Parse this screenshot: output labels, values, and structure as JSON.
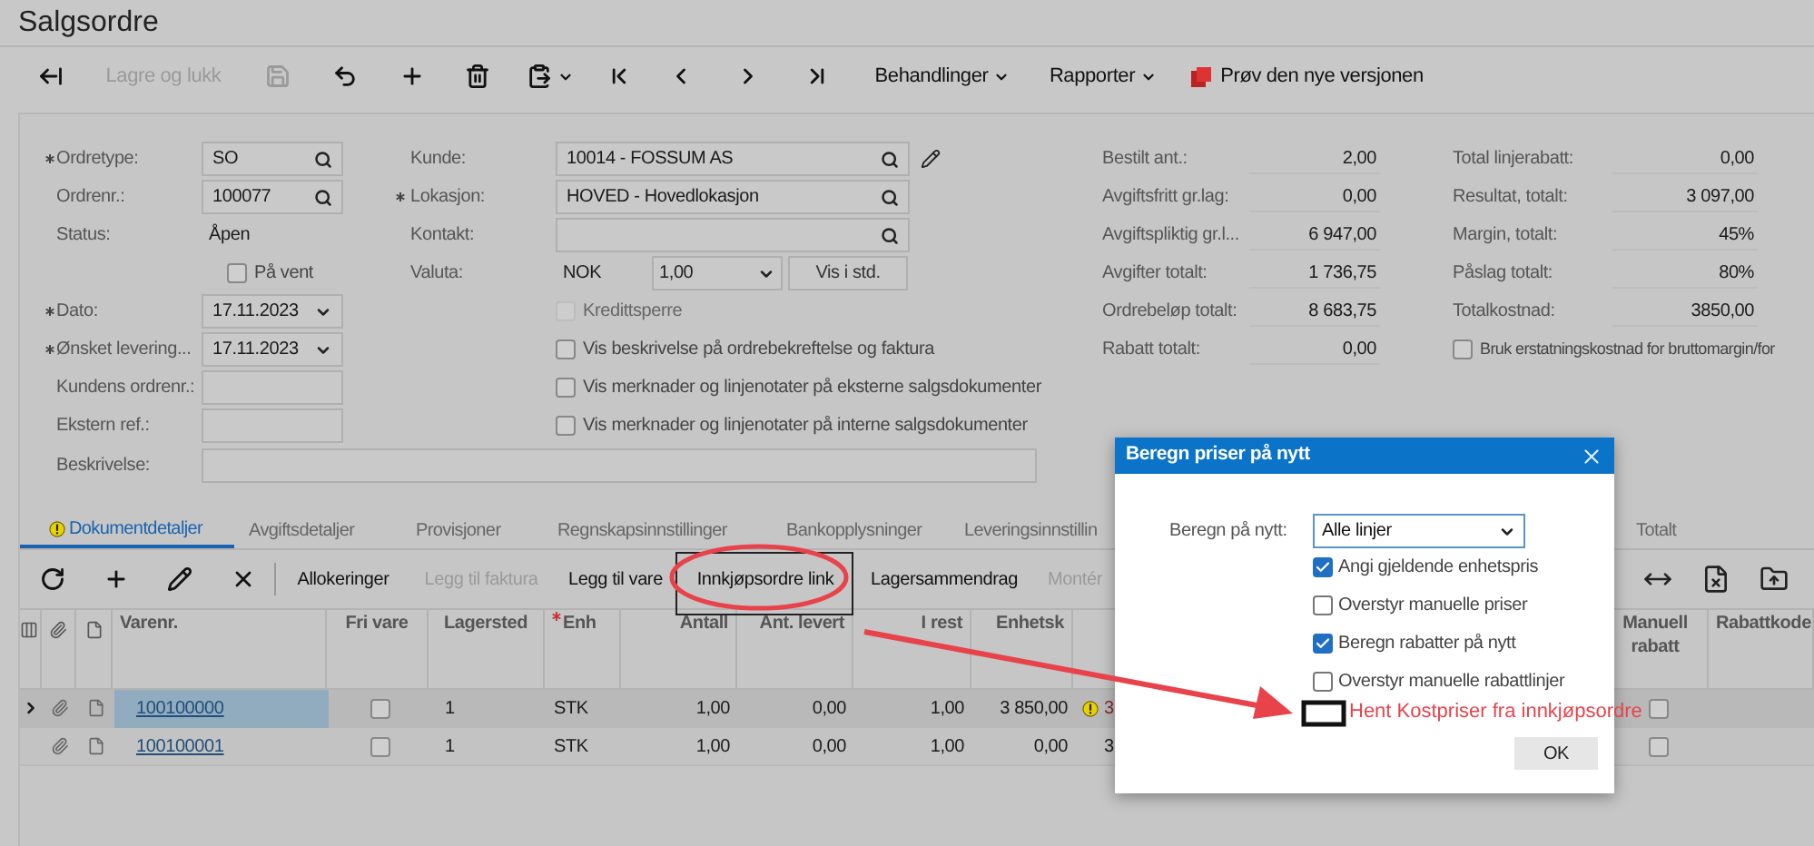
{
  "title": "Salgsordre",
  "toolbar": [
    {
      "kind": "icon",
      "disabled": false
    },
    {
      "kind": "text",
      "label": "Lagre og lukk",
      "disabled": true
    },
    {
      "kind": "icon",
      "disabled": true
    },
    {
      "kind": "icon",
      "disabled": false
    },
    {
      "kind": "icon",
      "disabled": false
    },
    {
      "kind": "icon",
      "disabled": false
    },
    {
      "kind": "icon-menu",
      "disabled": false
    },
    {
      "kind": "icon",
      "disabled": false
    },
    {
      "kind": "icon",
      "disabled": false
    },
    {
      "kind": "icon",
      "disabled": false
    },
    {
      "kind": "icon",
      "disabled": false
    },
    {
      "kind": "menu",
      "label": "Behandlinger",
      "disabled": false
    },
    {
      "kind": "menu",
      "label": "Rapporter",
      "disabled": false
    },
    {
      "kind": "promo",
      "label": "Prøv den nye versjonen",
      "disabled": false
    }
  ],
  "left_fields": [
    {
      "kind": "lookup",
      "label": "Ordretype:",
      "required": true,
      "value": "SO"
    },
    {
      "kind": "lookup",
      "label": "Ordrenr.:",
      "required": false,
      "value": "100077"
    },
    {
      "kind": "text",
      "label": "Status:",
      "required": false,
      "value": "Åpen"
    },
    {
      "kind": "checkbox",
      "label": "På vent",
      "checked": false
    },
    {
      "kind": "date",
      "label": "Dato:",
      "required": true,
      "value": "17.11.2023"
    },
    {
      "kind": "date",
      "label": "Ønsket levering...",
      "required": true,
      "value": "17.11.2023"
    },
    {
      "kind": "input",
      "label": "Kundens ordrenr.:",
      "required": false
    },
    {
      "kind": "input",
      "label": "Ekstern ref.:",
      "required": false
    }
  ],
  "description": {
    "label": "Beskrivelse:"
  },
  "middle_fields": [
    {
      "kind": "lookup_editable",
      "label": "Kunde:",
      "required": false,
      "value": "10014 - FOSSUM AS"
    },
    {
      "kind": "lookup",
      "label": "Lokasjon:",
      "required": true,
      "value": "HOVED - Hovedlokasjon"
    },
    {
      "kind": "lookup",
      "label": "Kontakt:",
      "required": false
    },
    {
      "kind": "currency",
      "label": "Valuta:",
      "required": false,
      "value": "NOK",
      "rate": "1,00",
      "button": "Vis i std."
    },
    {
      "kind": "checkbox",
      "label": "Kredittsperre",
      "checked": false,
      "disabled": true
    },
    {
      "kind": "checkbox",
      "label": "Vis beskrivelse på ordrebekreftelse og faktura",
      "checked": false,
      "disabled": false
    },
    {
      "kind": "checkbox",
      "label": "Vis merknader og linjenotater på eksterne salgsdokumenter",
      "checked": false,
      "disabled": false
    },
    {
      "kind": "checkbox",
      "label": "Vis merknader og linjenotater på interne salgsdokumenter",
      "checked": false,
      "disabled": false
    }
  ],
  "summary_1": [
    {
      "label": "Bestilt ant.:",
      "value": "2,00"
    },
    {
      "label": "Avgiftsfritt gr.lag:",
      "value": "0,00"
    },
    {
      "label": "Avgiftspliktig gr.l...",
      "value": "6 947,00"
    },
    {
      "label": "Avgifter totalt:",
      "value": "1 736,75"
    },
    {
      "label": "Ordrebeløp totalt:",
      "value": "8 683,75"
    },
    {
      "label": "Rabatt totalt:",
      "value": "0,00"
    }
  ],
  "summary_2": [
    {
      "label": "Total linjerabatt:",
      "value": "0,00"
    },
    {
      "label": "Resultat, totalt:",
      "value": "3 097,00"
    },
    {
      "label": "Margin, totalt:",
      "value": "45%"
    },
    {
      "label": "Påslag totalt:",
      "value": "80%"
    },
    {
      "label": "Totalkostnad:",
      "value": "3850,00"
    }
  ],
  "summary_checkbox": {
    "label": "Bruk erstatningskostnad for bruttomargin/for",
    "checked": false
  },
  "tabs": [
    {
      "label": "Dokumentdetaljer",
      "selected": true,
      "warning": true
    },
    {
      "label": "Avgiftsdetaljer",
      "selected": false,
      "warning": false
    },
    {
      "label": "Provisjoner",
      "selected": false,
      "warning": false
    },
    {
      "label": "Regnskapsinnstillinger",
      "selected": false,
      "warning": false
    },
    {
      "label": "Bankopplysninger",
      "selected": false,
      "warning": false
    },
    {
      "label": "Leveringsinnstillin",
      "selected": false,
      "warning": false
    },
    {
      "label": "Totalt",
      "selected": false,
      "warning": false
    }
  ],
  "grid_toolbar": [
    {
      "kind": "icon",
      "disabled": false
    },
    {
      "kind": "icon",
      "disabled": false
    },
    {
      "kind": "icon",
      "disabled": false
    },
    {
      "kind": "icon",
      "disabled": false
    },
    {
      "kind": "separator"
    },
    {
      "kind": "text",
      "label": "Allokeringer",
      "disabled": false
    },
    {
      "kind": "text",
      "label": "Legg til faktura",
      "disabled": true
    },
    {
      "kind": "text",
      "label": "Legg til vare",
      "disabled": false
    },
    {
      "kind": "text",
      "label": "Innkjøpsordre link",
      "disabled": false
    },
    {
      "kind": "text",
      "label": "Lagersammendrag",
      "disabled": false
    },
    {
      "kind": "text",
      "label": "Montér",
      "disabled": true
    }
  ],
  "table": {
    "columns": [
      {
        "label": "Varenr.",
        "required": false
      },
      {
        "label": "Fri vare",
        "required": false
      },
      {
        "label": "Lagersted",
        "required": false
      },
      {
        "label": "Enh",
        "required": true
      },
      {
        "label": "Antall",
        "required": false
      },
      {
        "label": "Ant. levert",
        "required": false
      },
      {
        "label": "I rest",
        "required": false
      },
      {
        "label": "Enhetsk",
        "required": false
      },
      {
        "label": "Manuell rabatt",
        "required": false
      },
      {
        "label": "Rabattkode",
        "required": false
      }
    ],
    "rows": [
      {
        "selected": true,
        "varenr": "100100000",
        "fri_vare": false,
        "lagersted": "1",
        "enh": "STK",
        "antall": "1,00",
        "levert": "0,00",
        "rest": "1,00",
        "enhetsk": "3 850,00",
        "warning": true,
        "column_9": "3",
        "manuell_rabatt": false
      },
      {
        "selected": false,
        "varenr": "100100001",
        "fri_vare": false,
        "lagersted": "1",
        "enh": "STK",
        "antall": "1,00",
        "levert": "0,00",
        "rest": "1,00",
        "enhetsk": "0,00",
        "warning": false,
        "column_9": "3",
        "manuell_rabatt": false
      }
    ]
  },
  "dialog": {
    "title": "Beregn priser på nytt",
    "select_label": "Beregn på nytt:",
    "select_value": "Alle linjer",
    "options": [
      {
        "label": "Angi gjeldende enhetspris",
        "checked": true
      },
      {
        "label": "Overstyr manuelle priser",
        "checked": false
      },
      {
        "label": "Beregn rabatter på nytt",
        "checked": true
      },
      {
        "label": "Overstyr manuelle rabattlinjer",
        "checked": false
      }
    ],
    "ok": "OK"
  },
  "annotation": {
    "label": "Hent Kostpriser fra innkjøpsordre"
  }
}
